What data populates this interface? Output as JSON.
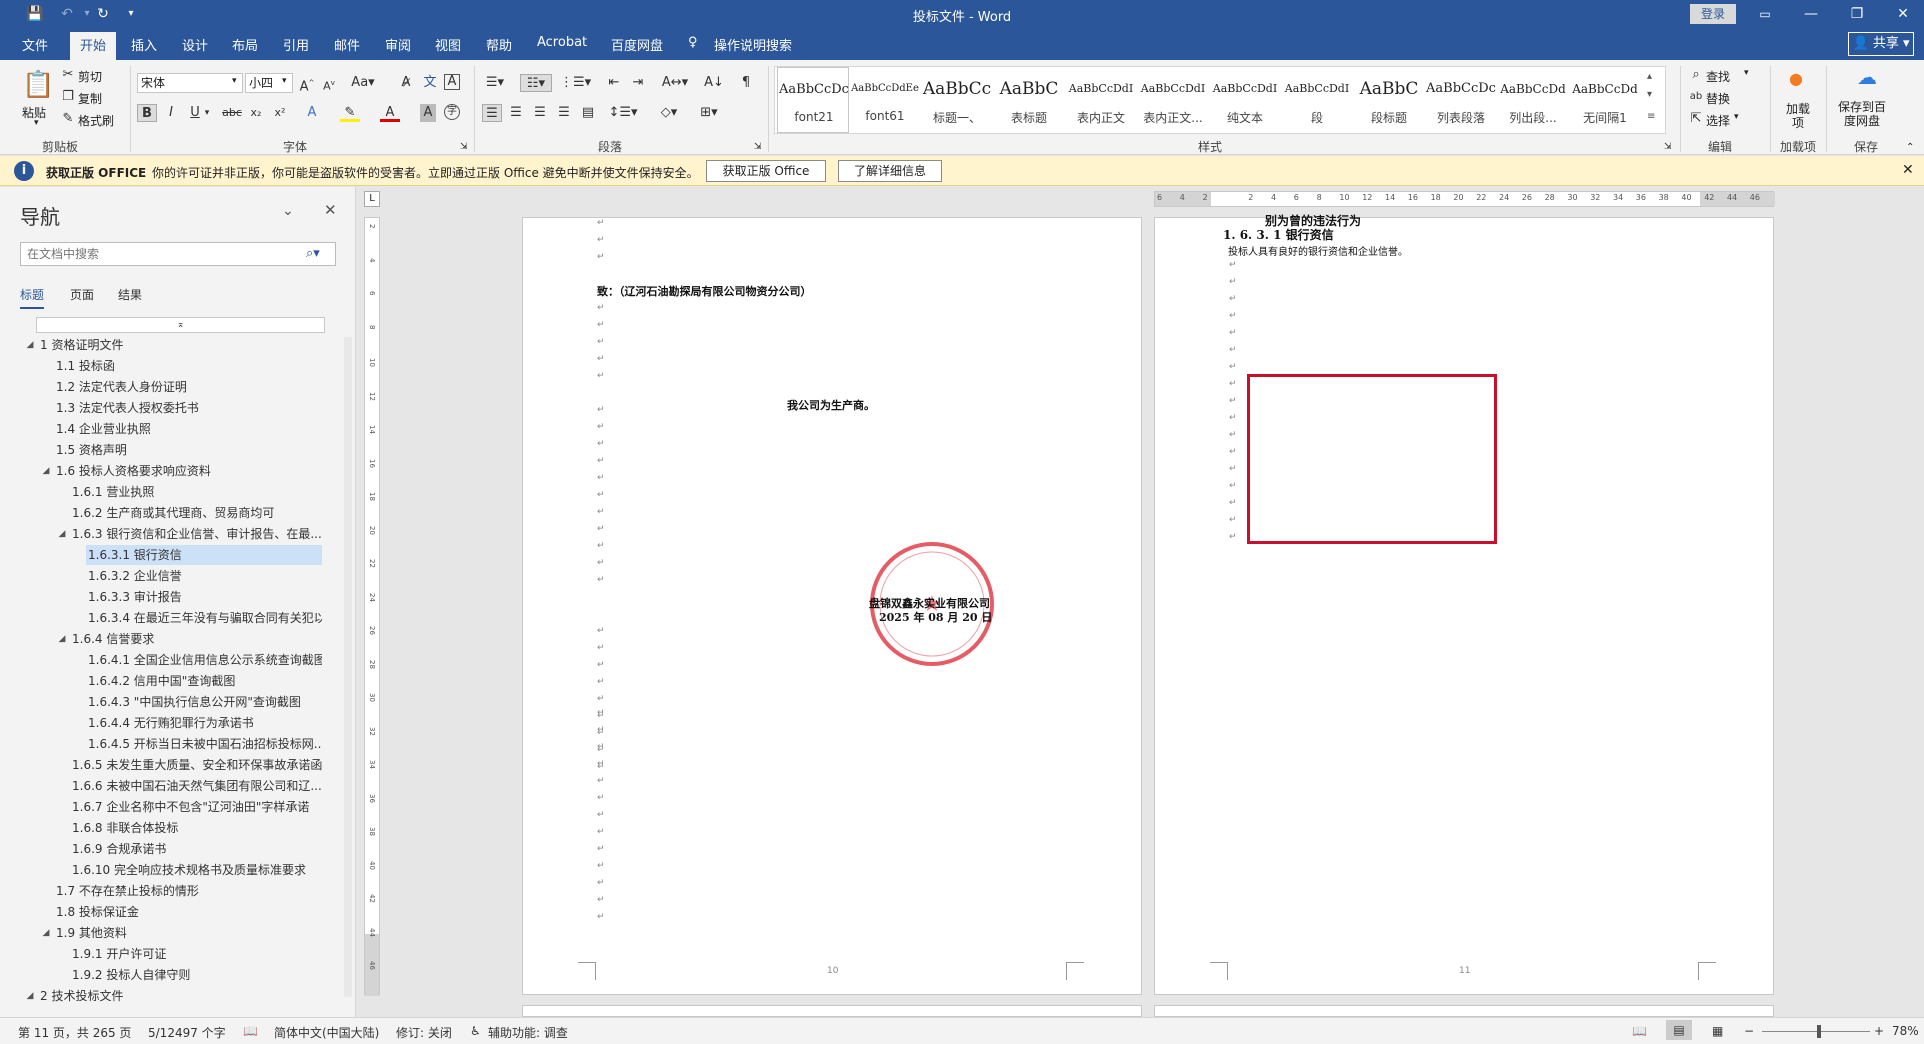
{
  "window": {
    "title": "投标文件 - Word",
    "login_label": "登录"
  },
  "quick_access": {
    "save_icon": "save-icon",
    "undo_icon": "undo-icon",
    "redo_icon": "redo-icon",
    "more_icon": "customize-icon"
  },
  "tabs": [
    {
      "label": "文件"
    },
    {
      "label": "开始"
    },
    {
      "label": "插入"
    },
    {
      "label": "设计"
    },
    {
      "label": "布局"
    },
    {
      "label": "引用"
    },
    {
      "label": "邮件"
    },
    {
      "label": "审阅"
    },
    {
      "label": "视图"
    },
    {
      "label": "帮助"
    },
    {
      "label": "Acrobat"
    },
    {
      "label": "百度网盘"
    },
    {
      "label": "操作说明搜索"
    }
  ],
  "share_label": "共享",
  "ribbon": {
    "clipboard": {
      "group": "剪贴板",
      "paste": "粘贴",
      "cut": "剪切",
      "copy": "复制",
      "format_painter": "格式刷"
    },
    "font": {
      "group": "字体",
      "font_name": "宋体",
      "font_size": "小四"
    },
    "paragraph": {
      "group": "段落"
    },
    "styles": {
      "group": "样式",
      "items": [
        {
          "preview": "AaBbCcDc",
          "name": "font21"
        },
        {
          "preview": "AaBbCcDdEe",
          "name": "font61"
        },
        {
          "preview": "AaBbCc",
          "name": "标题一、"
        },
        {
          "preview": "AaBbC",
          "name": "表标题"
        },
        {
          "preview": "AaBbCcDdI",
          "name": "表内正文"
        },
        {
          "preview": "AaBbCcDdI",
          "name": "表内正文..."
        },
        {
          "preview": "AaBbCcDdI",
          "name": "纯文本"
        },
        {
          "preview": "AaBbCcDdI",
          "name": "段"
        },
        {
          "preview": "AaBbC",
          "name": "段标题"
        },
        {
          "preview": "AaBbCcDc",
          "name": "列表段落"
        },
        {
          "preview": "AaBbCcDd",
          "name": "列出段..."
        },
        {
          "preview": "AaBbCcDd",
          "name": "无间隔1"
        }
      ]
    },
    "editing": {
      "group": "编辑",
      "find": "查找",
      "replace": "替换",
      "select": "选择"
    },
    "addins": {
      "group": "加载项",
      "label": "加载项"
    },
    "save": {
      "group": "保存",
      "label": "保存到百度网盘"
    }
  },
  "infobar": {
    "title": "获取正版 OFFICE",
    "message": "你的许可证并非正版，你可能是盗版软件的受害者。立即通过正版 Office 避免中断并使文件保持安全。",
    "btn_genuine": "获取正版 Office",
    "btn_details": "了解详细信息"
  },
  "nav": {
    "title": "导航",
    "search_placeholder": "在文档中搜索",
    "tabs": [
      "标题",
      "页面",
      "结果"
    ],
    "items": [
      {
        "text": "1 资格证明文件",
        "level": 0,
        "expand": "◢"
      },
      {
        "text": "1.1 投标函",
        "level": 1
      },
      {
        "text": "1.2 法定代表人身份证明",
        "level": 1
      },
      {
        "text": "1.3 法定代表人授权委托书",
        "level": 1
      },
      {
        "text": "1.4 企业营业执照",
        "level": 1
      },
      {
        "text": "1.5 资格声明",
        "level": 1
      },
      {
        "text": "1.6 投标人资格要求响应资料",
        "level": 1,
        "expand": "◢"
      },
      {
        "text": "1.6.1 营业执照",
        "level": 2
      },
      {
        "text": "1.6.2 生产商或其代理商、贸易商均可",
        "level": 2
      },
      {
        "text": "1.6.3 银行资信和企业信誉、审计报告、在最...",
        "level": 2,
        "expand": "◢"
      },
      {
        "text": "1.6.3.1 银行资信",
        "level": 3,
        "selected": true
      },
      {
        "text": "1.6.3.2 企业信誉",
        "level": 3
      },
      {
        "text": "1.6.3.3 审计报告",
        "level": 3
      },
      {
        "text": "1.6.3.4 在最近三年没有与骗取合同有关犯以...",
        "level": 3
      },
      {
        "text": "1.6.4 信誉要求",
        "level": 2,
        "expand": "◢"
      },
      {
        "text": "1.6.4.1 全国企业信用信息公示系统查询截图",
        "level": 3
      },
      {
        "text": "1.6.4.2 信用中国\"查询截图",
        "level": 3
      },
      {
        "text": "1.6.4.3 \"中国执行信息公开网\"查询截图",
        "level": 3
      },
      {
        "text": "1.6.4.4 无行贿犯罪行为承诺书",
        "level": 3
      },
      {
        "text": "1.6.4.5 开标当日未被中国石油招标投标网...",
        "level": 3
      },
      {
        "text": "1.6.5 未发生重大质量、安全和环保事故承诺函",
        "level": 2
      },
      {
        "text": "1.6.6 未被中国石油天然气集团有限公司和辽...",
        "level": 2
      },
      {
        "text": "1.6.7 企业名称中不包含\"辽河油田\"字样承诺",
        "level": 2
      },
      {
        "text": "1.6.8 非联合体投标",
        "level": 2
      },
      {
        "text": "1.6.9 合规承诺书",
        "level": 2
      },
      {
        "text": "1.6.10 完全响应技术规格书及质量标准要求",
        "level": 2
      },
      {
        "text": "1.7 不存在禁止投标的情形",
        "level": 1
      },
      {
        "text": "1.8 投标保证金",
        "level": 1
      },
      {
        "text": "1.9 其他资料",
        "level": 1,
        "expand": "◢"
      },
      {
        "text": "1.9.1 开户许可证",
        "level": 2
      },
      {
        "text": "1.9.2 投标人自律守则",
        "level": 2
      },
      {
        "text": "2 技术投标文件",
        "level": 0,
        "expand": "◢"
      }
    ]
  },
  "page_left": {
    "to_line": "致：（辽河石油勘探局有限公司物资分公司）",
    "statement": "我公司为生产商。",
    "company": "盘锦双鑫永实业有限公司",
    "date": "2025 年 08 月 20 日",
    "seal_text": "盘锦双鑫永实业有限公司",
    "page_no": "10"
  },
  "page_right": {
    "prev_line": "别为曾的违法行为",
    "heading": "1. 6. 3. 1 银行资信",
    "body": "投标人具有良好的银行资信和企业信誉。",
    "page_no": "11"
  },
  "ruler_numbers": [
    "6",
    "4",
    "2",
    "",
    "2",
    "4",
    "6",
    "8",
    "10",
    "12",
    "14",
    "16",
    "18",
    "20",
    "22",
    "24",
    "26",
    "28",
    "30",
    "32",
    "34",
    "36",
    "38",
    "40",
    "42",
    "44",
    "46"
  ],
  "vruler_numbers": [
    "2",
    "4",
    "6",
    "8",
    "10",
    "12",
    "14",
    "16",
    "18",
    "20",
    "22",
    "24",
    "26",
    "28",
    "30",
    "32",
    "34",
    "36",
    "38",
    "40",
    "42",
    "44",
    "46"
  ],
  "status": {
    "page": "第 11 页，共 265 页",
    "words": "5/12497 个字",
    "language": "简体中文(中国大陆)",
    "track": "修订: 关闭",
    "accessibility": "辅助功能: 调查",
    "zoom": "78%"
  },
  "colors": {
    "brand": "#2b579a",
    "infobar": "#fff4ce",
    "seal": "#e0404a",
    "highlight_box": "#c8102e"
  }
}
